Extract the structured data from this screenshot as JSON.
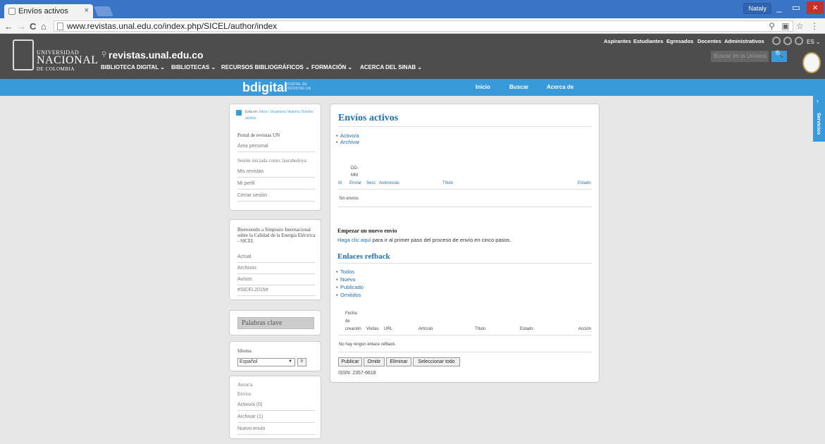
{
  "browser": {
    "tab_title": "Envíos activos",
    "tab_close": "×",
    "user": "Nataly",
    "win_min": "_",
    "win_max": "▭",
    "win_close": "×",
    "back": "←",
    "forward": "→",
    "reload": "C",
    "home": "⌂",
    "url": "www.revistas.unal.edu.co/index.php/SICEL/author/index",
    "addr_icons": "⚲ ▣ ☆ ⋮"
  },
  "header": {
    "logo_line1": "UNIVERSIDAD",
    "logo_line2": "NACIONAL",
    "logo_line3": "DE COLOMBIA",
    "site_icon": "⚲",
    "site_name": "revistas.unal.edu.co",
    "menu": [
      "BIBLIOTECA DIGITAL ⌄",
      "BIBLIOTECAS ⌄",
      "RECURSOS BIBLIOGRÁFICOS ⌄",
      "FORMACIÓN ⌄",
      "ACERCA DEL SINAB ⌄"
    ],
    "top_links": [
      "Aspirantes",
      "Estudiantes",
      "Egresados",
      "Docentes",
      "Administrativos"
    ],
    "lang": "ES ⌄",
    "search_placeholder": "Buscar en la Universi",
    "search_icon": "🔍"
  },
  "portal": {
    "brand": "bdigital",
    "brand_sub": "PORTAL DE REVISTAS UN",
    "links": [
      "Inicio",
      "Buscar",
      "Acerca de"
    ],
    "servicios": "Servicios",
    "servicios_chevron": "‹"
  },
  "sidebar": {
    "breadcrumb_prefix": "Está en:",
    "breadcrumb": "Inicio / Usuario/a / Autor/a / Envíos activos",
    "portal_title": "Portal de revistas UN",
    "area_personal": "Área personal",
    "session": "Sesión iniciada como: laurabedoya",
    "mis_revistas": "Mis revistas",
    "mi_perfil": "Mi perfil",
    "cerrar_sesion": "Cerrar sesión",
    "welcome": "Bienvenido a Simposio Internacional sobre la Calidad de la Energía Eléctrica - SICEL",
    "actual": "Actual",
    "archivos": "Archivos",
    "avisos": "Avisos",
    "hashtag": "#SICEL2015#",
    "keywords": "Palabras clave",
    "idioma_label": "Idioma",
    "idioma_value": "Español",
    "idioma_go": "Ir",
    "autor_label": "Autor/a",
    "envios_label": "Envíos",
    "activos": "Activo/a (0)",
    "archivar": "Archivar (1)",
    "nuevo_envio": "Nuevo envío"
  },
  "main": {
    "title": "Envíos activos",
    "filters": [
      "Activo/a",
      "Archivar"
    ],
    "table_headers": {
      "id": "Id",
      "date_lines": [
        "DD-",
        "MM"
      ],
      "enviar": "Enviar",
      "secc": "Secc",
      "autores": "Autores/as",
      "titulo": "Título",
      "estado": "Estado"
    },
    "empty": "Sin envíos",
    "new_title": "Empezar un nuevo envío",
    "new_link": "Haga clic aquí",
    "new_text": " para ir al primer paso del proceso de envío en cinco pasos.",
    "refback_title": "Enlaces refback",
    "refback_filters": [
      "Todos",
      "Nuevo",
      "Publicado",
      "Omitidos"
    ],
    "ref_headers": {
      "fecha_lines": [
        "Fecha",
        "de",
        "creación"
      ],
      "visitas": "Visitas",
      "url": "URL",
      "articulo": "Artículo",
      "titulo": "Título",
      "estado": "Estado",
      "accion": "Acción"
    },
    "ref_empty": "No hay ningún enlace refback.",
    "buttons": [
      "Publicar",
      "Omitir",
      "Eliminar",
      "Seleccionar todo"
    ],
    "issn": "ISSN: 2357-6618"
  }
}
